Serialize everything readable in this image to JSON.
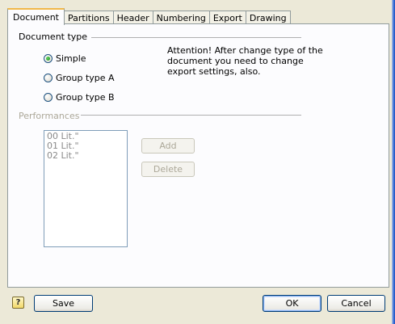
{
  "tabs": [
    {
      "label": "Document",
      "active": true
    },
    {
      "label": "Partitions",
      "active": false
    },
    {
      "label": "Header",
      "active": false
    },
    {
      "label": "Numbering",
      "active": false
    },
    {
      "label": "Export",
      "active": false
    },
    {
      "label": "Drawing",
      "active": false
    }
  ],
  "document_type": {
    "title": "Document type",
    "options": [
      {
        "label": "Simple",
        "checked": true
      },
      {
        "label": "Group type A",
        "checked": false
      },
      {
        "label": "Group type B",
        "checked": false
      }
    ],
    "note": "Attention! After change type of the document you need to change export settings, also."
  },
  "performances": {
    "title": "Performances",
    "enabled": false,
    "items": [
      "00 Lit.\"",
      "01 Lit.\"",
      "02 Lit.\""
    ],
    "add_label": "Add",
    "delete_label": "Delete"
  },
  "footer": {
    "help_icon": "help-icon",
    "help_glyph": "?",
    "save_label": "Save",
    "ok_label": "OK",
    "cancel_label": "Cancel"
  },
  "colors": {
    "dialog_bg": "#ece9d8",
    "page_bg": "#fcfcfe",
    "active_tab_accent": "#f1b84a",
    "selected_radio": "#1f8a1f",
    "disabled_text": "#aca899"
  }
}
